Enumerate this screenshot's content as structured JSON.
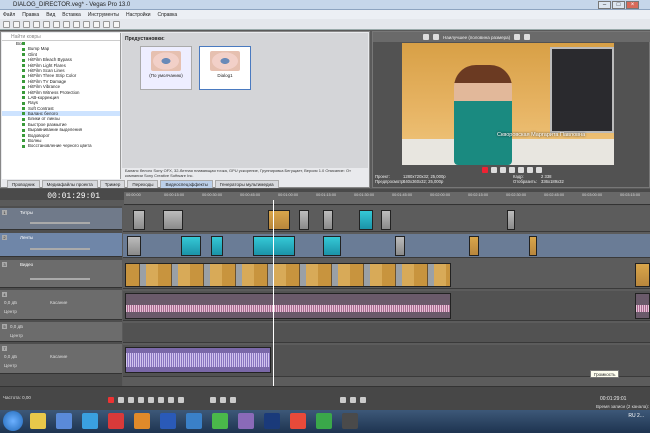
{
  "window": {
    "title": "DIALOG_DIRECTOR.veg* - Vegas Pro 13.0"
  },
  "menu": [
    "Файл",
    "Правка",
    "Вид",
    "Вставка",
    "Инструменты",
    "Настройки",
    "Справка"
  ],
  "explorer": {
    "filter_placeholder": "Найти ковры",
    "items": [
      "Все",
      "Bump Map",
      "Glint",
      "HitFilm Bleach Bypass",
      "HitFilm Light Flares",
      "HitFilm Scan Lines",
      "HitFilm Three Strip Color",
      "HitFilm TV Damage",
      "HitFilm Vibrance",
      "HitFilm Witness Protection",
      "LAB-коррекция",
      "Rays",
      "Soft Contrast",
      "Баланс белого",
      "Блики от линзы",
      "Быстрое размытие",
      "Выравнивание выделения",
      "Водоворот",
      "Волны",
      "Восстановление черного цвета"
    ],
    "selected_index": 13
  },
  "presets": {
    "header": "Предустановки:",
    "items": [
      {
        "label": "(По умолчанию)"
      },
      {
        "label": "Dialog1"
      }
    ],
    "description": "Баланс белого Sony OFX, 32-битная плавающая точка, GPU ускорение, Группировка Бегущает, Версия 1.0 Описание: От компании Sony Creative Software Inc."
  },
  "left_tabs": [
    "Проводник",
    "Медиафайлы проекта",
    "Тример",
    "Переходы",
    "Видеоспецэффекты",
    "Генераторы мультимедиа"
  ],
  "left_tabs_active": 4,
  "preview": {
    "mode": "Наилучшее (половина размера)",
    "caption": "Скворовская Маргарита Павловна",
    "info": {
      "project_label": "Проект:",
      "project_value": "1280x720x32; 25,000p",
      "preview_label": "Предпросмотр:",
      "preview_value": "640x360x32; 25,000p",
      "frame_label": "Кадр:",
      "frame_value": "2 338",
      "display_label": "Отобразить:",
      "display_value": "336x189x32"
    }
  },
  "timeline": {
    "timecode": "00:01:29:01",
    "ruler": [
      "00:00:00",
      "00:00:15:00",
      "00:00:30:00",
      "00:00:45:00",
      "00:01:00:00",
      "00:01:15:00",
      "00:01:30:00",
      "00:01:45:00",
      "00:02:00:00",
      "00:02:15:00",
      "00:02:30:00",
      "00:02:45:00",
      "00:03:00:00",
      "00:03:15:00"
    ],
    "tracks": [
      {
        "num": "1",
        "name": "Титры"
      },
      {
        "num": "2",
        "name": "Ленты"
      },
      {
        "num": "3",
        "name": "Видео"
      },
      {
        "num": "4",
        "level": "0,0 дБ",
        "pan": "Центр",
        "mode": "Касание"
      },
      {
        "num": "5",
        "level": "0,0 дБ",
        "pan": "Центр"
      },
      {
        "num": "7",
        "level": "0,0 дБ",
        "pan": "Центр",
        "mode": "Касание"
      }
    ],
    "tooltip": "Громкость"
  },
  "bottom": {
    "rate_label": "Частота: 0,00",
    "end_time": "00:01:29:01",
    "status": "Время записи (2 канала): 5"
  },
  "taskbar": {
    "time": "2...",
    "lang": "RU"
  }
}
